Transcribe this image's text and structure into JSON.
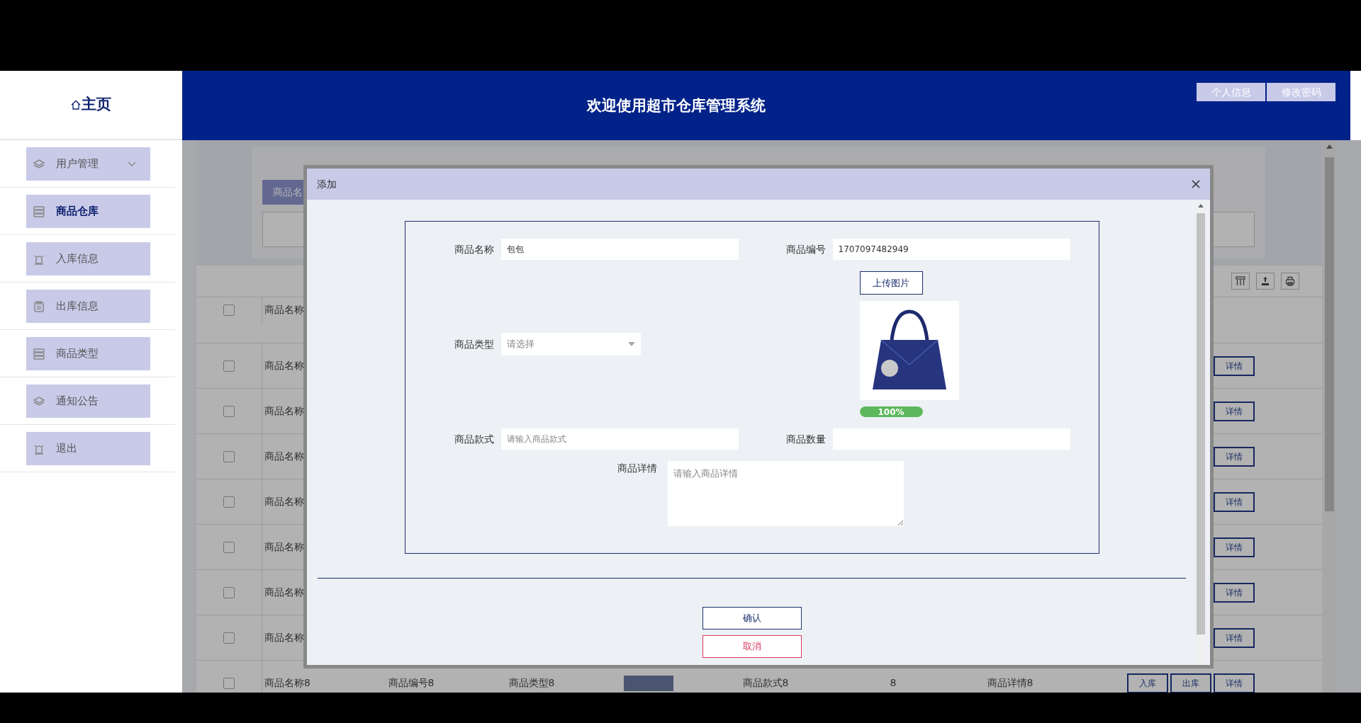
{
  "sidebar": {
    "home": "主页",
    "items": [
      {
        "label": "用户管理",
        "expandable": true,
        "selected": false
      },
      {
        "label": "商品仓库",
        "expandable": false,
        "selected": true
      },
      {
        "label": "入库信息",
        "expandable": false,
        "selected": false
      },
      {
        "label": "出库信息",
        "expandable": false,
        "selected": false
      },
      {
        "label": "商品类型",
        "expandable": false,
        "selected": false
      },
      {
        "label": "通知公告",
        "expandable": false,
        "selected": false
      },
      {
        "label": "退出",
        "expandable": false,
        "selected": false
      }
    ]
  },
  "header": {
    "title": "欢迎使用超市仓库管理系统",
    "buttons": [
      "个人信息",
      "修改密码"
    ]
  },
  "search": {
    "label": "商品名"
  },
  "table": {
    "header": {
      "name": "商品名称",
      "checked": false
    },
    "rows": [
      {
        "name": "商品名称",
        "checked": false,
        "actions": [
          "详情"
        ]
      },
      {
        "name": "商品名称",
        "checked": false,
        "actions": [
          "详情"
        ]
      },
      {
        "name": "商品名称",
        "checked": false,
        "actions": [
          "详情"
        ]
      },
      {
        "name": "商品名称",
        "checked": false,
        "actions": [
          "详情"
        ]
      },
      {
        "name": "商品名称",
        "checked": false,
        "actions": [
          "详情"
        ]
      },
      {
        "name": "商品名称",
        "checked": false,
        "actions": [
          "详情"
        ]
      },
      {
        "name": "商品名称",
        "checked": false,
        "actions": [
          "详情"
        ]
      },
      {
        "name": "商品名称8",
        "checked": false,
        "code": "商品编号8",
        "type": "商品类型8",
        "image": true,
        "style": "商品款式8",
        "quantity": "8",
        "details": "商品详情8",
        "actions": [
          "入库",
          "出库",
          "详情"
        ]
      }
    ]
  },
  "dialog": {
    "title": "添加",
    "fields": [
      {
        "kind": "text",
        "label": "商品名称",
        "value": "包包"
      },
      {
        "kind": "text",
        "label": "商品编号",
        "value": "1707097482949"
      },
      {
        "kind": "select",
        "label": "商品类型",
        "placeholder": "请选择"
      },
      {
        "kind": "upload",
        "button": "上传图片",
        "progress": "100%",
        "level": 1
      },
      {
        "kind": "text",
        "label": "商品款式",
        "placeholder": "请输入商品款式"
      },
      {
        "kind": "text",
        "label": "商品数量"
      },
      {
        "kind": "textarea",
        "label": "商品详情",
        "placeholder": "请输入商品详情"
      }
    ],
    "buttons": [
      {
        "label": "确认",
        "kind": "confirm"
      },
      {
        "label": "取消",
        "kind": "cancel"
      }
    ]
  }
}
